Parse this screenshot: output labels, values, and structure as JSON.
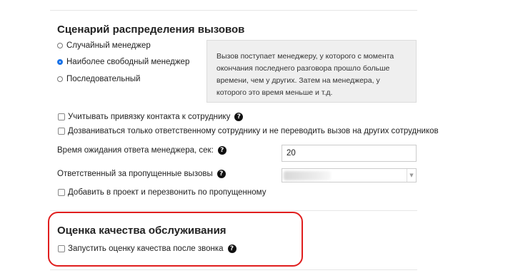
{
  "distribution": {
    "title": "Сценарий распределения вызовов",
    "options": [
      {
        "label": "Случайный менеджер",
        "selected": false
      },
      {
        "label": "Наиболее свободный менеджер",
        "selected": true
      },
      {
        "label": "Последовательный",
        "selected": false
      }
    ],
    "description": "Вызов поступает менеджеру, у которого с момента окончания последнего разговора прошло больше времени, чем у других. Затем на менеджера, у которого это время меньше и т.д."
  },
  "options": {
    "contact_binding_label": "Учитывать привязку контакта к сотруднику",
    "only_responsible_label": "Дозваниваться только ответственному сотруднику и не переводить вызов на других сотрудников"
  },
  "wait_time": {
    "label": "Время ожидания ответа менеджера, сек:",
    "value": "20"
  },
  "missed_calls": {
    "label": "Ответственный за пропущенные вызовы",
    "selected_value": "",
    "dropdown_icon": "chevron-down-icon",
    "add_project_label": "Добавить в проект и перезвонить по пропущенному"
  },
  "quality": {
    "title": "Оценка качества обслуживания",
    "start_rating_label": "Запустить оценку качества после звонка"
  },
  "help_icon_glyph": "?",
  "colors": {
    "accent": "#1a73e8",
    "highlight": "#e01e1e",
    "infobox_bg": "#efefef"
  }
}
